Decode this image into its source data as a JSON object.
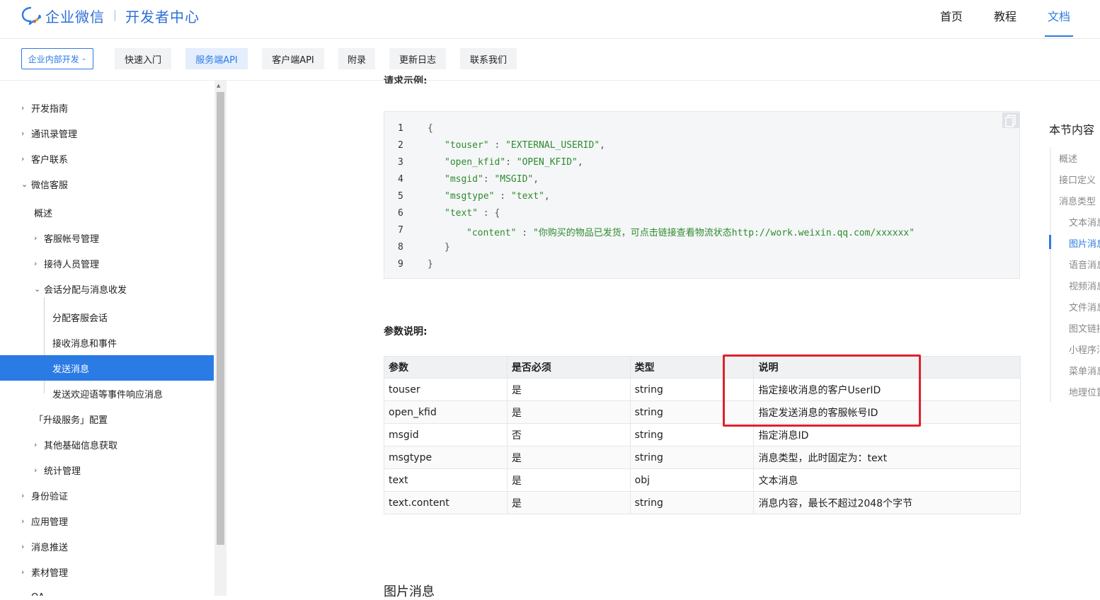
{
  "header": {
    "brand": "企业微信",
    "subtitle": "开发者中心",
    "nav": [
      {
        "label": "首页",
        "active": false
      },
      {
        "label": "教程",
        "active": false
      },
      {
        "label": "文档",
        "active": true
      }
    ]
  },
  "subnav": {
    "select_label": "企业内部开发",
    "tabs": [
      {
        "label": "快速入门",
        "active": false
      },
      {
        "label": "服务端API",
        "active": true
      },
      {
        "label": "客户端API",
        "active": false
      },
      {
        "label": "附录",
        "active": false
      },
      {
        "label": "更新日志",
        "active": false
      },
      {
        "label": "联系我们",
        "active": false
      }
    ]
  },
  "sidebar": {
    "items": [
      {
        "label": "开发指南",
        "chevron": "right",
        "active": false
      },
      {
        "label": "通讯录管理",
        "chevron": "right",
        "active": false
      },
      {
        "label": "客户联系",
        "chevron": "right",
        "active": false
      },
      {
        "label": "微信客服",
        "chevron": "down",
        "active": false
      },
      {
        "label": "概述",
        "chevron": "",
        "active": false
      },
      {
        "label": "客服帐号管理",
        "chevron": "right",
        "active": false
      },
      {
        "label": "接待人员管理",
        "chevron": "right",
        "active": false
      },
      {
        "label": "会话分配与消息收发",
        "chevron": "down",
        "active": false
      },
      {
        "label": "分配客服会话",
        "chevron": "",
        "active": false
      },
      {
        "label": "接收消息和事件",
        "chevron": "",
        "active": false
      },
      {
        "label": "发送消息",
        "chevron": "",
        "active": true
      },
      {
        "label": "发送欢迎语等事件响应消息",
        "chevron": "",
        "active": false
      },
      {
        "label": "「升级服务」配置",
        "chevron": "",
        "active": false
      },
      {
        "label": "其他基础信息获取",
        "chevron": "right",
        "active": false
      },
      {
        "label": "统计管理",
        "chevron": "right",
        "active": false
      },
      {
        "label": "身份验证",
        "chevron": "right",
        "active": false
      },
      {
        "label": "应用管理",
        "chevron": "right",
        "active": false
      },
      {
        "label": "消息推送",
        "chevron": "right",
        "active": false
      },
      {
        "label": "素材管理",
        "chevron": "right",
        "active": false
      },
      {
        "label": "OA",
        "chevron": "right",
        "active": false
      }
    ]
  },
  "content": {
    "cut_heading": "请求示例:",
    "code": {
      "line_numbers": [
        "1",
        "2",
        "3",
        "4",
        "5",
        "6",
        "7",
        "8",
        "9"
      ],
      "l1": "{",
      "l2_key": "\"touser\"",
      "l2_sep": " : ",
      "l2_val": "\"EXTERNAL_USERID\"",
      "l2_end": ",",
      "l3_key": "\"open_kfid\"",
      "l3_sep": ": ",
      "l3_val": "\"OPEN_KFID\"",
      "l3_end": ",",
      "l4_key": "\"msgid\"",
      "l4_sep": ": ",
      "l4_val": "\"MSGID\"",
      "l4_end": ",",
      "l5_key": "\"msgtype\"",
      "l5_sep": " : ",
      "l5_val": "\"text\"",
      "l5_end": ",",
      "l6_key": "\"text\"",
      "l6_sep": " : {",
      "l7_key": "\"content\"",
      "l7_sep": " : ",
      "l7_val": "\"你购买的物品已发货，可点击链接查看物流状态http://work.weixin.qq.com/xxxxxx\"",
      "l8": "}",
      "l9": "}"
    },
    "param_title": "参数说明:",
    "table": {
      "headers": [
        "参数",
        "是否必须",
        "类型",
        "说明"
      ],
      "rows": [
        [
          "touser",
          "是",
          "string",
          "指定接收消息的客户UserID"
        ],
        [
          "open_kfid",
          "是",
          "string",
          "指定发送消息的客服帐号ID"
        ],
        [
          "msgid",
          "否",
          "string",
          "指定消息ID"
        ],
        [
          "msgtype",
          "是",
          "string",
          "消息类型，此时固定为：text"
        ],
        [
          "text",
          "是",
          "obj",
          "文本消息"
        ],
        [
          "text.content",
          "是",
          "string",
          "消息内容，最长不超过2048个字节"
        ]
      ]
    },
    "next_section": "图片消息"
  },
  "toc": {
    "title": "本节内容",
    "items": [
      {
        "label": "概述",
        "active": false
      },
      {
        "label": "接口定义",
        "active": false
      },
      {
        "label": "消息类型",
        "active": false
      },
      {
        "label": "文本消息",
        "active": false
      },
      {
        "label": "图片消息",
        "active": true
      },
      {
        "label": "语音消息",
        "active": false
      },
      {
        "label": "视频消息",
        "active": false
      },
      {
        "label": "文件消息",
        "active": false
      },
      {
        "label": "图文链接",
        "active": false
      },
      {
        "label": "小程序消息",
        "active": false
      },
      {
        "label": "菜单消息",
        "active": false
      },
      {
        "label": "地理位置",
        "active": false
      }
    ]
  },
  "colors": {
    "accent": "#2b7be5",
    "highlight_box": "#e0202d",
    "code_string": "#2e8b2e"
  }
}
